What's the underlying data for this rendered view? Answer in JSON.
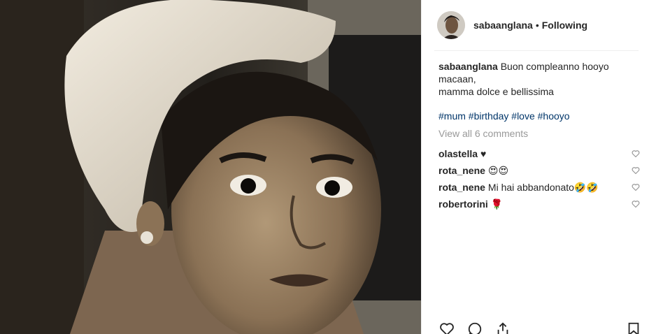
{
  "header": {
    "username": "sabaanglana",
    "separator": "•",
    "follow_state": "Following"
  },
  "caption": {
    "username": "sabaanglana",
    "line1": "Buon compleanno hooyo macaan,",
    "line2": "mamma dolce e bellissima"
  },
  "hashtags": [
    "#mum",
    "#birthday",
    "#love",
    "#hooyo"
  ],
  "view_all_comments": "View all 6 comments",
  "comments": [
    {
      "user": "olastella",
      "text": "♥"
    },
    {
      "user": "rota_nene",
      "text": "😍😍"
    },
    {
      "user": "rota_nene",
      "text": "Mi hai abbandonato🤣🤣"
    },
    {
      "user": "robertorini",
      "text": "🌹"
    }
  ],
  "icons": {
    "comment_like": "heart-outline-icon",
    "like": "heart-outline-icon",
    "comment": "speech-bubble-icon",
    "share": "share-icon",
    "save": "bookmark-icon"
  },
  "colors": {
    "hashtag": "#003569",
    "muted": "#999999",
    "text": "#262626",
    "divider": "#efefef"
  }
}
